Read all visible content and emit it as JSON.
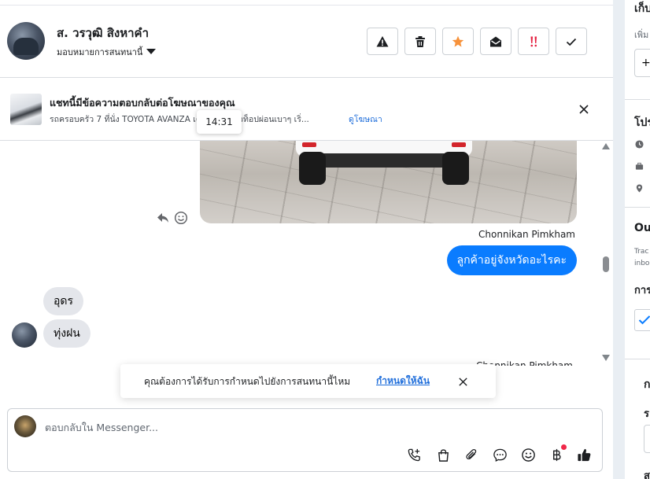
{
  "header": {
    "contact_name": "ส. วรวุฒิ สิงหาคำ",
    "assign_label": "มอบหมายการสนทนานี้",
    "actions": [
      {
        "name": "spam-button",
        "icon": "warning-icon"
      },
      {
        "name": "delete-button",
        "icon": "trash-icon"
      },
      {
        "name": "star-button",
        "icon": "star-icon",
        "color": "#f7923b"
      },
      {
        "name": "mark-unread-button",
        "icon": "envelope-open-icon"
      },
      {
        "name": "follow-up-button",
        "icon": "exclamation-icon",
        "color": "#e41e3f"
      },
      {
        "name": "mark-done-button",
        "icon": "check-icon"
      }
    ]
  },
  "ad_banner": {
    "title": "แชทนี้มีข้อความตอบกลับต่อโฆษณาของคุณ",
    "description": "รถครอบครัว 7 ที่นั่ง TOYOTA AVANZA เครื่อง 1.5 ตัวท็อปผ่อนเบาๆ เริ่...",
    "link": "ดูโฆษณา"
  },
  "tooltip": {
    "time": "14:31"
  },
  "messages": {
    "outgoing_sender": "Chonnikan Pimkham",
    "outgoing_text": "ลูกค้าอยู่จังหวัดอะไรคะ",
    "incoming": [
      "อุดร",
      "ทุ่งฝน"
    ],
    "partial_sender": "Chonnikan Pimkham"
  },
  "prompt": {
    "text": "คุณต้องการได้รับการกำหนดไปยังการสนทนานี้ไหม",
    "link": "กำหนดให้ฉัน"
  },
  "composer": {
    "placeholder": "ตอบกลับใน Messenger...",
    "tools": [
      "call-add-icon",
      "shopping-bag-icon",
      "paperclip-icon",
      "chat-bubble-icon",
      "emoji-icon",
      "baht-icon",
      "thumbs-up-icon"
    ],
    "accent": "#0a7cff"
  },
  "side_panel": {
    "section_1_title": "เก็บ",
    "section_1_sub": "เพิ่ม",
    "add_button": "+",
    "section_2_title": "โปร",
    "section_3_title": "Ou",
    "section_3_desc_1": "Trac",
    "section_3_desc_2": "inbo",
    "section_3_label": "การ",
    "section_4_title": "ก",
    "section_4_sub": "ร",
    "section_4_footer": "ส"
  }
}
